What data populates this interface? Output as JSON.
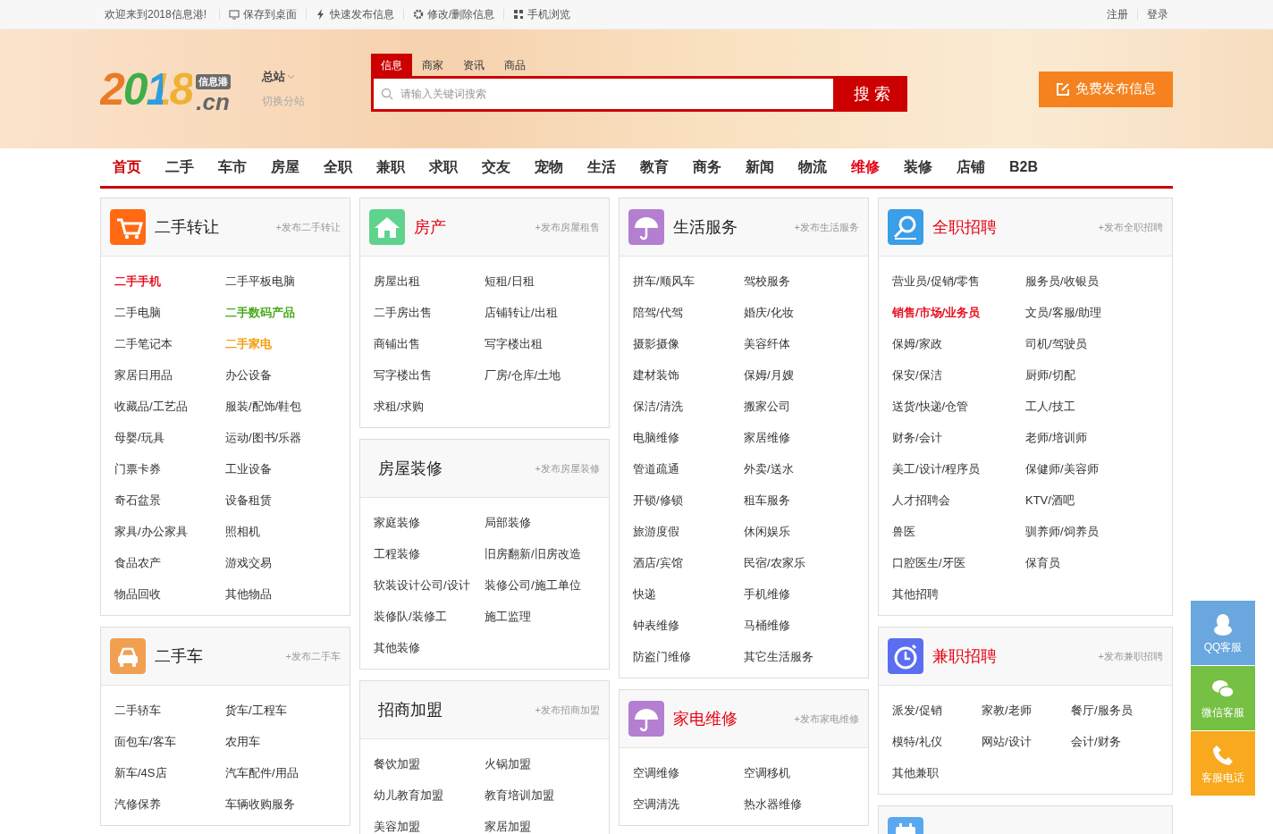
{
  "top_bar": {
    "welcome": "欢迎来到2018信息港!",
    "links": [
      {
        "label": "保存到桌面"
      },
      {
        "label": "快速发布信息"
      },
      {
        "label": "修改/删除信息"
      },
      {
        "label": "手机浏览"
      }
    ],
    "account": [
      "注册",
      "登录"
    ]
  },
  "logo": {
    "text": "2018",
    "badge": "信息港",
    "domain": ".cn"
  },
  "branch": {
    "name": "总站",
    "switch": "切换分站"
  },
  "search": {
    "tabs": [
      {
        "label": "信息",
        "selected": true
      },
      {
        "label": "商家",
        "selected": false
      },
      {
        "label": "资讯",
        "selected": false
      },
      {
        "label": "商品",
        "selected": false
      }
    ],
    "placeholder": "请输入关键词搜索",
    "button": "搜 索"
  },
  "publish_button": "免费发布信息",
  "nav": [
    {
      "label": "首页",
      "selected": true,
      "hot": false
    },
    {
      "label": "二手",
      "selected": false,
      "hot": false
    },
    {
      "label": "车市",
      "selected": false,
      "hot": false
    },
    {
      "label": "房屋",
      "selected": false,
      "hot": false
    },
    {
      "label": "全职",
      "selected": false,
      "hot": false
    },
    {
      "label": "兼职",
      "selected": false,
      "hot": false
    },
    {
      "label": "求职",
      "selected": false,
      "hot": false
    },
    {
      "label": "交友",
      "selected": false,
      "hot": false
    },
    {
      "label": "宠物",
      "selected": false,
      "hot": false
    },
    {
      "label": "生活",
      "selected": false,
      "hot": false
    },
    {
      "label": "教育",
      "selected": false,
      "hot": false
    },
    {
      "label": "商务",
      "selected": false,
      "hot": false
    },
    {
      "label": "新闻",
      "selected": false,
      "hot": false
    },
    {
      "label": "物流",
      "selected": false,
      "hot": false
    },
    {
      "label": "维修",
      "selected": false,
      "hot": true
    },
    {
      "label": "装修",
      "selected": false,
      "hot": false
    },
    {
      "label": "店铺",
      "selected": false,
      "hot": false
    },
    {
      "label": "B2B",
      "selected": false,
      "hot": false
    }
  ],
  "columns": [
    {
      "panels": [
        {
          "title": "二手转让",
          "highlighted": false,
          "link": "+发布二手转让",
          "kind": "two-column",
          "items": [
            {
              "label": "二手手机",
              "color": "#e60012"
            },
            {
              "label": "二手平板电脑"
            },
            {
              "label": "二手电脑"
            },
            {
              "label": "二手数码产品",
              "color": "#3aa40a"
            },
            {
              "label": "二手笔记本"
            },
            {
              "label": "二手家电",
              "color": "#f39800"
            },
            {
              "label": "家居日用品"
            },
            {
              "label": "办公设备"
            },
            {
              "label": "收藏品/工艺品"
            },
            {
              "label": "服装/配饰/鞋包"
            },
            {
              "label": "母婴/玩具"
            },
            {
              "label": "运动/图书/乐器"
            },
            {
              "label": "门票卡券"
            },
            {
              "label": "工业设备"
            },
            {
              "label": "奇石盆景"
            },
            {
              "label": "设备租赁"
            },
            {
              "label": "家具/办公家具"
            },
            {
              "label": "照相机"
            },
            {
              "label": "食品农产"
            },
            {
              "label": "游戏交易"
            },
            {
              "label": "物品回收"
            },
            {
              "label": "其他物品"
            }
          ]
        },
        {
          "title": "二手车",
          "highlighted": false,
          "link": "+发布二手车",
          "kind": "two-column",
          "items": [
            {
              "label": "二手轿车"
            },
            {
              "label": "货车/工程车"
            },
            {
              "label": "面包车/客车"
            },
            {
              "label": "农用车"
            },
            {
              "label": "新车/4S店"
            },
            {
              "label": "汽车配件/用品"
            },
            {
              "label": "汽修保养"
            },
            {
              "label": "车辆收购服务"
            }
          ]
        }
      ]
    },
    {
      "panels": [
        {
          "title": "房产",
          "highlighted": true,
          "link": "+发布房屋租售",
          "kind": "two-column",
          "items": [
            {
              "label": "房屋出租"
            },
            {
              "label": "短租/日租"
            },
            {
              "label": "二手房出售"
            },
            {
              "label": "店铺转让/出租"
            },
            {
              "label": "商铺出售"
            },
            {
              "label": "写字楼出租"
            },
            {
              "label": "写字楼出售"
            },
            {
              "label": "厂房/仓库/土地"
            },
            {
              "label": "求租/求购"
            }
          ]
        },
        {
          "title": "房屋装修",
          "highlighted": false,
          "link": "+发布房屋装修",
          "kind": "two-column",
          "items": [
            {
              "label": "家庭装修"
            },
            {
              "label": "局部装修"
            },
            {
              "label": "工程装修"
            },
            {
              "label": "旧房翻新/旧房改造"
            },
            {
              "label": "软装设计公司/设计"
            },
            {
              "label": "装修公司/施工单位"
            },
            {
              "label": "装修队/装修工"
            },
            {
              "label": "施工监理"
            },
            {
              "label": "其他装修"
            }
          ]
        },
        {
          "title": "招商加盟",
          "highlighted": false,
          "link": "+发布招商加盟",
          "kind": "two-column",
          "items": [
            {
              "label": "餐饮加盟"
            },
            {
              "label": "火锅加盟"
            },
            {
              "label": "幼儿教育加盟"
            },
            {
              "label": "教育培训加盟"
            },
            {
              "label": "美容加盟"
            },
            {
              "label": "家居加盟"
            }
          ]
        }
      ]
    },
    {
      "panels": [
        {
          "title": "生活服务",
          "highlighted": false,
          "link": "+发布生活服务",
          "kind": "two-column",
          "items": [
            {
              "label": "拼车/顺风车"
            },
            {
              "label": "驾校服务"
            },
            {
              "label": "陪驾/代驾"
            },
            {
              "label": "婚庆/化妆"
            },
            {
              "label": "摄影摄像"
            },
            {
              "label": "美容纤体"
            },
            {
              "label": "建材装饰"
            },
            {
              "label": "保姆/月嫂"
            },
            {
              "label": "保洁/清洗"
            },
            {
              "label": "搬家公司"
            },
            {
              "label": "电脑维修"
            },
            {
              "label": "家居维修"
            },
            {
              "label": "管道疏通"
            },
            {
              "label": "外卖/送水"
            },
            {
              "label": "开锁/修锁"
            },
            {
              "label": "租车服务"
            },
            {
              "label": "旅游度假"
            },
            {
              "label": "休闲娱乐"
            },
            {
              "label": "酒店/宾馆"
            },
            {
              "label": "民宿/农家乐"
            },
            {
              "label": "快递"
            },
            {
              "label": "手机维修"
            },
            {
              "label": "钟表维修"
            },
            {
              "label": "马桶维修"
            },
            {
              "label": "防盗门维修"
            },
            {
              "label": "其它生活服务"
            }
          ]
        },
        {
          "title": "家电维修",
          "highlighted": true,
          "link": "+发布家电维修",
          "kind": "two-column",
          "items": [
            {
              "label": "空调维修"
            },
            {
              "label": "空调移机"
            },
            {
              "label": "空调清洗"
            },
            {
              "label": "热水器维修"
            }
          ]
        }
      ]
    },
    {
      "panels": [
        {
          "title": "全职招聘",
          "highlighted": true,
          "link": "+发布全职招聘",
          "kind": "two-column",
          "items": [
            {
              "label": "营业员/促销/零售"
            },
            {
              "label": "服务员/收银员"
            },
            {
              "label": "销售/市场/业务员",
              "color": "#e60012"
            },
            {
              "label": "文员/客服/助理"
            },
            {
              "label": "保姆/家政"
            },
            {
              "label": "司机/驾驶员"
            },
            {
              "label": "保安/保洁"
            },
            {
              "label": "厨师/切配"
            },
            {
              "label": "送货/快递/仓管"
            },
            {
              "label": "工人/技工"
            },
            {
              "label": "财务/会计"
            },
            {
              "label": "老师/培训师"
            },
            {
              "label": "美工/设计/程序员"
            },
            {
              "label": "保健师/美容师"
            },
            {
              "label": "人才招聘会"
            },
            {
              "label": "KTV/酒吧"
            },
            {
              "label": "兽医"
            },
            {
              "label": "驯养师/饲养员"
            },
            {
              "label": "口腔医生/牙医"
            },
            {
              "label": "保育员"
            },
            {
              "label": "其他招聘"
            }
          ]
        },
        {
          "title": "兼职招聘",
          "highlighted": true,
          "link": "+发布兼职招聘",
          "kind": "three-column",
          "items": [
            {
              "label": "派发/促销"
            },
            {
              "label": "家教/老师"
            },
            {
              "label": "餐厅/服务员"
            },
            {
              "label": "模特/礼仪"
            },
            {
              "label": "网站/设计"
            },
            {
              "label": "会计/财务"
            },
            {
              "label": "其他兼职"
            }
          ]
        },
        {
          "kind": "two-column"
        }
      ]
    }
  ],
  "side_buttons": [
    {
      "label": "QQ客服",
      "color": "#6aa7de"
    },
    {
      "label": "微信客服",
      "color": "#76c043"
    },
    {
      "label": "客服电话",
      "color": "#f8a91d"
    }
  ]
}
